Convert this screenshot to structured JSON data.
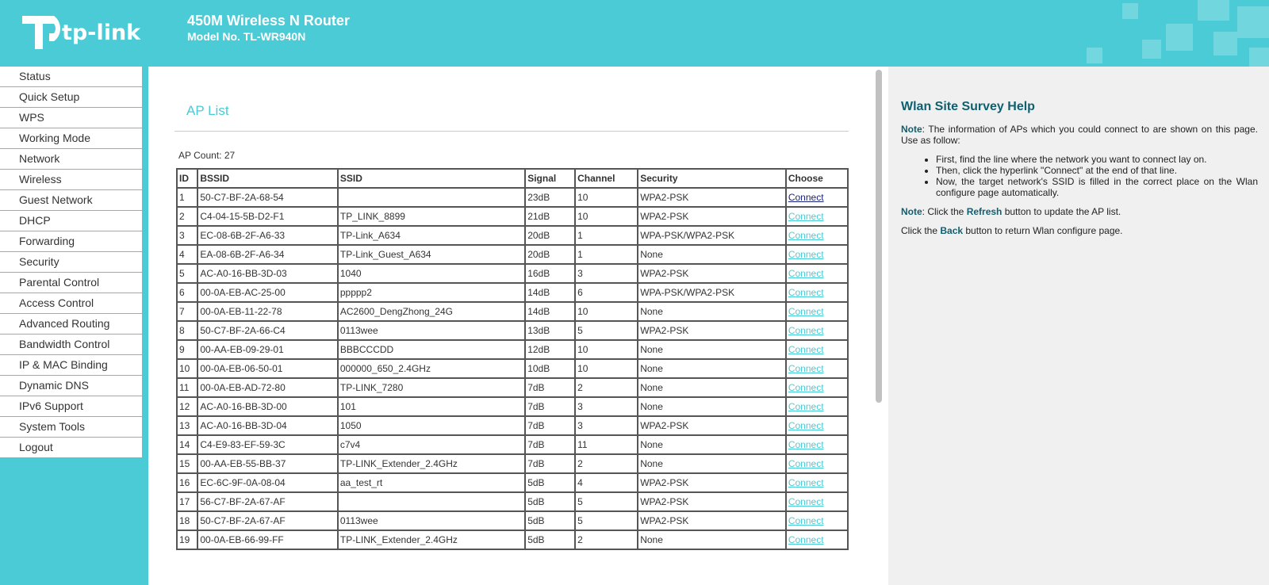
{
  "header": {
    "logo_text": "tp-link",
    "title": "450M Wireless N Router",
    "model": "Model No. TL-WR940N"
  },
  "sidebar": {
    "items": [
      "Status",
      "Quick Setup",
      "WPS",
      "Working Mode",
      "Network",
      "Wireless",
      "Guest Network",
      "DHCP",
      "Forwarding",
      "Security",
      "Parental Control",
      "Access Control",
      "Advanced Routing",
      "Bandwidth Control",
      "IP & MAC Binding",
      "Dynamic DNS",
      "IPv6 Support",
      "System Tools",
      "Logout"
    ]
  },
  "main": {
    "title": "AP List",
    "ap_count": "AP Count: 27",
    "columns": [
      "ID",
      "BSSID",
      "SSID",
      "Signal",
      "Channel",
      "Security",
      "Choose"
    ],
    "connect_label": "Connect",
    "rows": [
      [
        "1",
        "50-C7-BF-2A-68-54",
        "",
        "23dB",
        "10",
        "WPA2-PSK"
      ],
      [
        "2",
        "C4-04-15-5B-D2-F1",
        "TP_LINK_8899",
        "21dB",
        "10",
        "WPA2-PSK"
      ],
      [
        "3",
        "EC-08-6B-2F-A6-33",
        "TP-Link_A634",
        "20dB",
        "1",
        "WPA-PSK/WPA2-PSK"
      ],
      [
        "4",
        "EA-08-6B-2F-A6-34",
        "TP-Link_Guest_A634",
        "20dB",
        "1",
        "None"
      ],
      [
        "5",
        "AC-A0-16-BB-3D-03",
        "1040",
        "16dB",
        "3",
        "WPA2-PSK"
      ],
      [
        "6",
        "00-0A-EB-AC-25-00",
        "ppppp2",
        "14dB",
        "6",
        "WPA-PSK/WPA2-PSK"
      ],
      [
        "7",
        "00-0A-EB-11-22-78",
        "AC2600_DengZhong_24G",
        "14dB",
        "10",
        "None"
      ],
      [
        "8",
        "50-C7-BF-2A-66-C4",
        "0113wee",
        "13dB",
        "5",
        "WPA2-PSK"
      ],
      [
        "9",
        "00-AA-EB-09-29-01",
        "BBBCCCDD",
        "12dB",
        "10",
        "None"
      ],
      [
        "10",
        "00-0A-EB-06-50-01",
        "000000_650_2.4GHz",
        "10dB",
        "10",
        "None"
      ],
      [
        "11",
        "00-0A-EB-AD-72-80",
        "TP-LINK_7280",
        "7dB",
        "2",
        "None"
      ],
      [
        "12",
        "AC-A0-16-BB-3D-00",
        "101",
        "7dB",
        "3",
        "None"
      ],
      [
        "13",
        "AC-A0-16-BB-3D-04",
        "1050",
        "7dB",
        "3",
        "WPA2-PSK"
      ],
      [
        "14",
        "C4-E9-83-EF-59-3C",
        "c7v4",
        "7dB",
        "11",
        "None"
      ],
      [
        "15",
        "00-AA-EB-55-BB-37",
        "TP-LINK_Extender_2.4GHz",
        "7dB",
        "2",
        "None"
      ],
      [
        "16",
        "EC-6C-9F-0A-08-04",
        "aa_test_rt",
        "5dB",
        "4",
        "WPA2-PSK"
      ],
      [
        "17",
        "56-C7-BF-2A-67-AF",
        "",
        "5dB",
        "5",
        "WPA2-PSK"
      ],
      [
        "18",
        "50-C7-BF-2A-67-AF",
        "0113wee",
        "5dB",
        "5",
        "WPA2-PSK"
      ],
      [
        "19",
        "00-0A-EB-66-99-FF",
        "TP-LINK_Extender_2.4GHz",
        "5dB",
        "2",
        "None"
      ]
    ]
  },
  "help": {
    "title": "Wlan Site Survey Help",
    "note_label": "Note",
    "p1": ": The information of APs which you could connect to are shown on this page. Use as follow:",
    "bullets": [
      "First, find the line where the network you want to connect lay on.",
      "Then, click the hyperlink \"Connect\" at the end of that line.",
      "Now, the target network's SSID is filled in the correct place on the Wlan configure page automatically."
    ],
    "p2_pre": ": Click the ",
    "refresh": "Refresh",
    "p2_post": " button to update the AP list.",
    "p3_pre": "Click the ",
    "back": "Back",
    "p3_post": " button to return Wlan configure page."
  }
}
